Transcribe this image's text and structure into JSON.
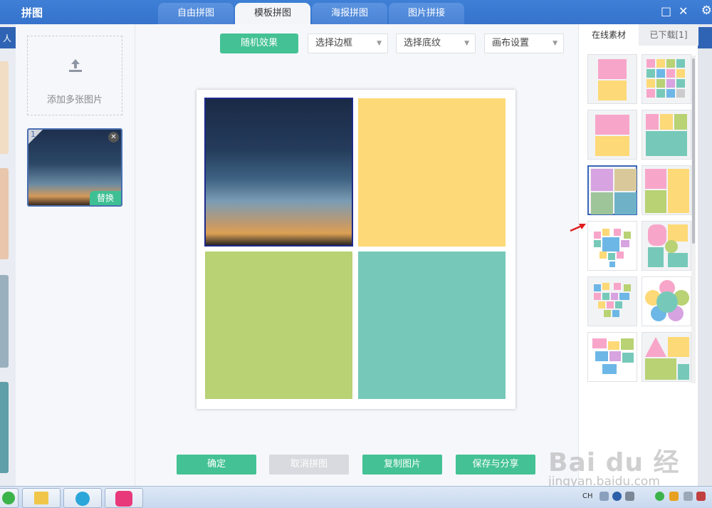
{
  "app": {
    "title": "拼图"
  },
  "tabs": [
    {
      "label": "自由拼图"
    },
    {
      "label": "模板拼图"
    },
    {
      "label": "海报拼图"
    },
    {
      "label": "图片拼接"
    }
  ],
  "window_controls": {
    "maximize": "□",
    "close": "✕",
    "settings": "⚙"
  },
  "behind_text": "人",
  "left_panel": {
    "add_label": "添加多张图片",
    "photo_index": "1",
    "replace_label": "替换",
    "remove_glyph": "✕"
  },
  "toolbar": {
    "random_label": "随机效果",
    "border_label": "选择边框",
    "texture_label": "选择底纹",
    "canvas_label": "画布设置",
    "caret": "▼"
  },
  "canvas": {
    "colors": {
      "yellow": "#fdd977",
      "green": "#b8d274",
      "teal": "#76c9b9"
    }
  },
  "bottom_buttons": {
    "confirm": "确定",
    "cancel": "取消拼图",
    "copy": "复制图片",
    "save": "保存与分享"
  },
  "right_panel": {
    "tab_online": "在线素材",
    "tab_downloaded": "已下载[1]"
  },
  "watermark": {
    "brand": "Bai du 经验",
    "site": "jingyan.baidu.com"
  },
  "taskbar": {
    "lang": "CH"
  },
  "colors": {
    "accent": "#44c295",
    "titlebar": "#3a78d2",
    "selection": "#3a66b8"
  }
}
